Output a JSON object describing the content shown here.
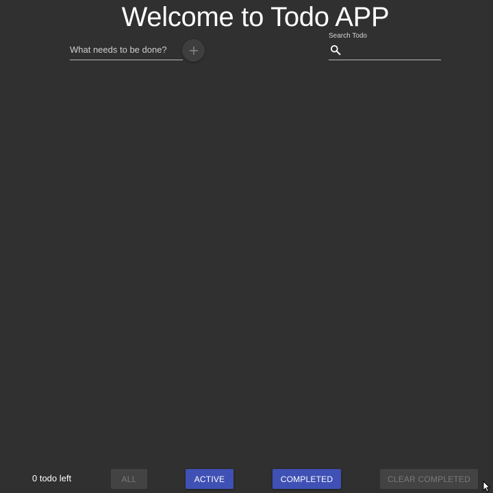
{
  "header": {
    "title": "Welcome to Todo APP"
  },
  "new_todo": {
    "placeholder": "What needs to be done?",
    "value": "",
    "add_icon": "plus-icon"
  },
  "search": {
    "label": "Search Todo",
    "value": "",
    "icon": "search-icon"
  },
  "footer": {
    "count_text": "0 todo left",
    "buttons": {
      "all": "ALL",
      "active": "ACTIVE",
      "completed": "COMPLETED",
      "clear_completed": "CLEAR COMPLETED"
    }
  },
  "colors": {
    "background": "#303030",
    "primary": "#3f51b5",
    "disabled_bg": "#434343",
    "disabled_text": "#7a7a7a"
  }
}
